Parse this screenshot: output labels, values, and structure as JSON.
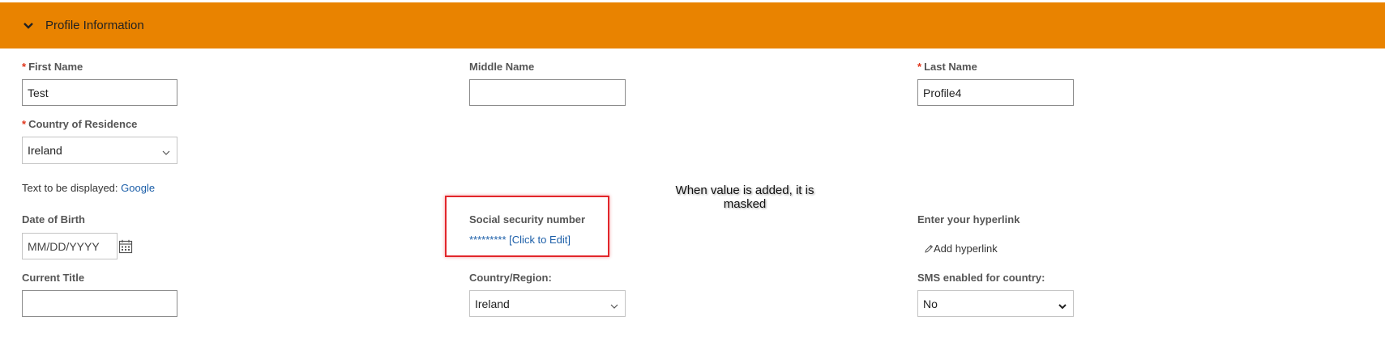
{
  "section": {
    "title": "Profile Information",
    "icon": "chevron-down-icon"
  },
  "required_marker": "*",
  "first_name": {
    "label": "First Name",
    "value": "Test"
  },
  "middle_name": {
    "label": "Middle Name",
    "value": ""
  },
  "last_name": {
    "label": "Last Name",
    "value": "Profile4"
  },
  "country_of_residence": {
    "label": "Country of Residence",
    "value": "Ireland"
  },
  "display_text": {
    "prefix": "Text to be displayed:",
    "link": "Google"
  },
  "callout": {
    "line1": "When value is added, it is",
    "line2": "masked"
  },
  "date_of_birth": {
    "label": "Date of Birth",
    "placeholder": "MM/DD/YYYY",
    "icon": "calendar-icon"
  },
  "ssn": {
    "label": "Social security number",
    "masked": "*********",
    "edit_link": "[Click to Edit]"
  },
  "hyperlink": {
    "label": "Enter your hyperlink",
    "add_label": "Add hyperlink",
    "icon": "pencil-icon"
  },
  "current_title": {
    "label": "Current Title",
    "value": ""
  },
  "country_region": {
    "label": "Country/Region:",
    "value": "Ireland"
  },
  "sms": {
    "label": "SMS enabled for country:",
    "value": "No"
  },
  "colors": {
    "header": "#e98300",
    "required": "#e0341a",
    "link": "#1b5ea8",
    "highlight": "#e2262b"
  }
}
